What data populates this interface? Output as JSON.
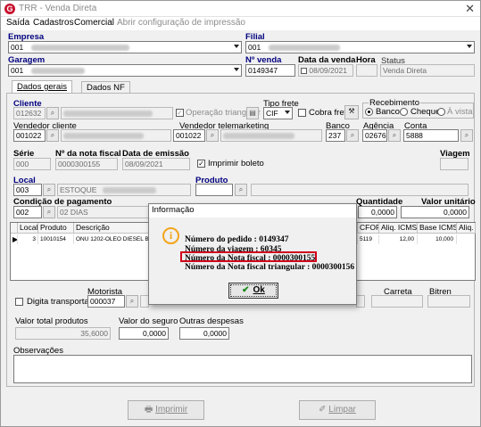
{
  "window": {
    "title": "TRR - Venda Direta",
    "close": "✕"
  },
  "menu": [
    "Saída",
    "Cadastros",
    "Comercial",
    "Abrir configuração de impressão"
  ],
  "header": {
    "empresa_label": "Empresa",
    "empresa_code": "001",
    "filial_label": "Filial",
    "filial_code": "001",
    "garagem_label": "Garagem",
    "garagem_code": "001",
    "nvenda_label": "Nº venda",
    "nvenda_value": "0149347",
    "data_label": "Data da venda",
    "data_value": "08/09/2021",
    "hora_label": "Hora",
    "hora_value": "15:10",
    "status_label": "Status",
    "status_value": "Venda Direta"
  },
  "tabs": [
    "Dados gerais",
    "Dados NF"
  ],
  "cliente": {
    "label": "Cliente",
    "code": "012632",
    "triangular_label": "Operação triangular",
    "tipo_frete_label": "Tipo frete",
    "tipo_frete_value": "CIF",
    "cobra_frete_label": "Cobra frete",
    "recebimento_label": "Recebimento",
    "rec_banco": "Banco",
    "rec_cheque": "Cheque",
    "rec_avista": "À vista"
  },
  "vendedores": {
    "cliente_label": "Vendedor cliente",
    "cliente_code": "001022",
    "tele_label": "Vendedor telemarketing",
    "tele_code": "001022",
    "banco_label": "Banco",
    "banco_value": "237",
    "agencia_label": "Agência",
    "agencia_value": "02676",
    "conta_label": "Conta",
    "conta_value": "5888"
  },
  "nota": {
    "serie_label": "Série",
    "serie_value": "000",
    "nf_label": "Nº da nota fiscal",
    "nf_value": "0000300155",
    "emissao_label": "Data de emissão",
    "emissao_value": "08/09/2021",
    "imprimir_label": "Imprimir boleto",
    "viagem_label": "Viagem"
  },
  "local": {
    "label": "Local",
    "code": "003",
    "name": "ESTOQUE",
    "produto_label": "Produto"
  },
  "pagamento": {
    "label": "Condição de pagamento",
    "code": "002",
    "name": "02 DIAS",
    "quantidade_label": "Quantidade",
    "quantidade_value": "0,0000",
    "valor_label": "Valor unitário",
    "valor_value": "0,0000"
  },
  "grid": {
    "headers": [
      "Local",
      "Produto",
      "Descrição",
      "CFOP",
      "Aliq. ICMS",
      "Base ICMS",
      "Aliq. ir"
    ],
    "row": [
      "3",
      "10010154",
      "ONU 1202-OLEO DIESEL B",
      "5119",
      "12,00",
      "10,000"
    ]
  },
  "transport": {
    "digita_label": "Digita transportador",
    "motorista_label": "Motorista",
    "motorista_code": "000037",
    "carreta_label": "Carreta",
    "bitren_label": "Bitren"
  },
  "totais": {
    "produtos_label": "Valor total produtos",
    "produtos_value": "35,6000",
    "seguro_label": "Valor do seguro",
    "seguro_value": "0,0000",
    "outras_label": "Outras despesas",
    "outras_value": "0,0000",
    "obs_label": "Observações"
  },
  "buttons": {
    "imprimir": "Imprimir",
    "limpar": "Limpar"
  },
  "dialog": {
    "title": "Informação",
    "line1": "Número do pedido      : 0149347",
    "line2": "Número da viagem      : 60345",
    "line3": "Número da Nota fiscal : 0000300155",
    "line4": "Número da Nota fiscal triangular : 0000300156",
    "ok": "Ok"
  }
}
